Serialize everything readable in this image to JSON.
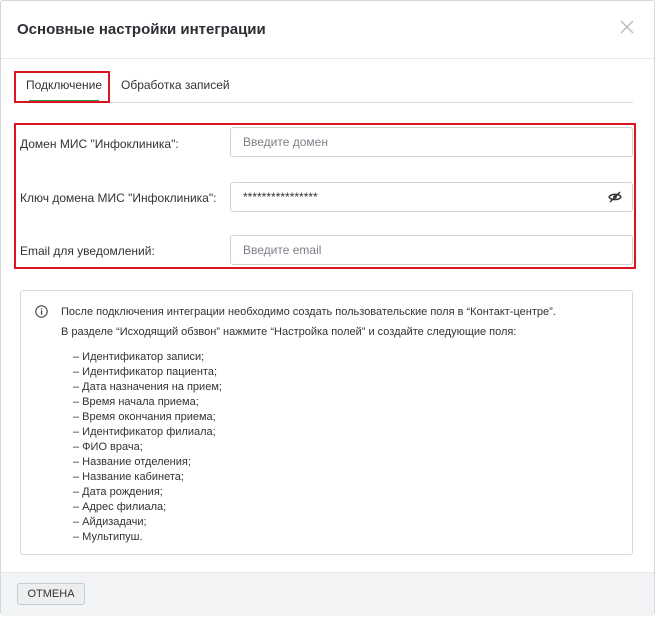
{
  "dialog": {
    "title": "Основные настройки интеграции"
  },
  "tabs": [
    {
      "label": "Подключение",
      "active": true
    },
    {
      "label": "Обработка записей",
      "active": false
    }
  ],
  "form": {
    "domain": {
      "label": "Домен МИС \"Инфоклиника\":",
      "placeholder": "Введите домен",
      "value": ""
    },
    "key": {
      "label": "Ключ домена МИС \"Инфоклиника\":",
      "value": "****************"
    },
    "email": {
      "label": "Email для уведомлений:",
      "placeholder": "Введите email",
      "value": ""
    }
  },
  "info": {
    "line1": "После подключения интеграции необходимо создать пользовательские поля в “Контакт-центре”.",
    "line2": "В разделе “Исходящий обзвон” нажмите “Настройка полей” и создайте следующие поля:",
    "items": [
      "– Идентификатор записи;",
      "– Идентификатор пациента;",
      "– Дата назначения на прием;",
      "– Время начала приема;",
      "– Время окончания приема;",
      "– Идентификатор филиала;",
      "– ФИО врача;",
      "– Название отделения;",
      "– Название кабинета;",
      "– Дата рождения;",
      "– Адрес филиала;",
      "– Айдизадачи;",
      "– Мультипуш."
    ]
  },
  "footer": {
    "cancel_label": "ОТМЕНА"
  },
  "colors": {
    "accent": "#2e9e4f",
    "highlight": "#d9161f"
  },
  "icons": [
    "close-icon",
    "eye-off-icon",
    "info-icon"
  ]
}
